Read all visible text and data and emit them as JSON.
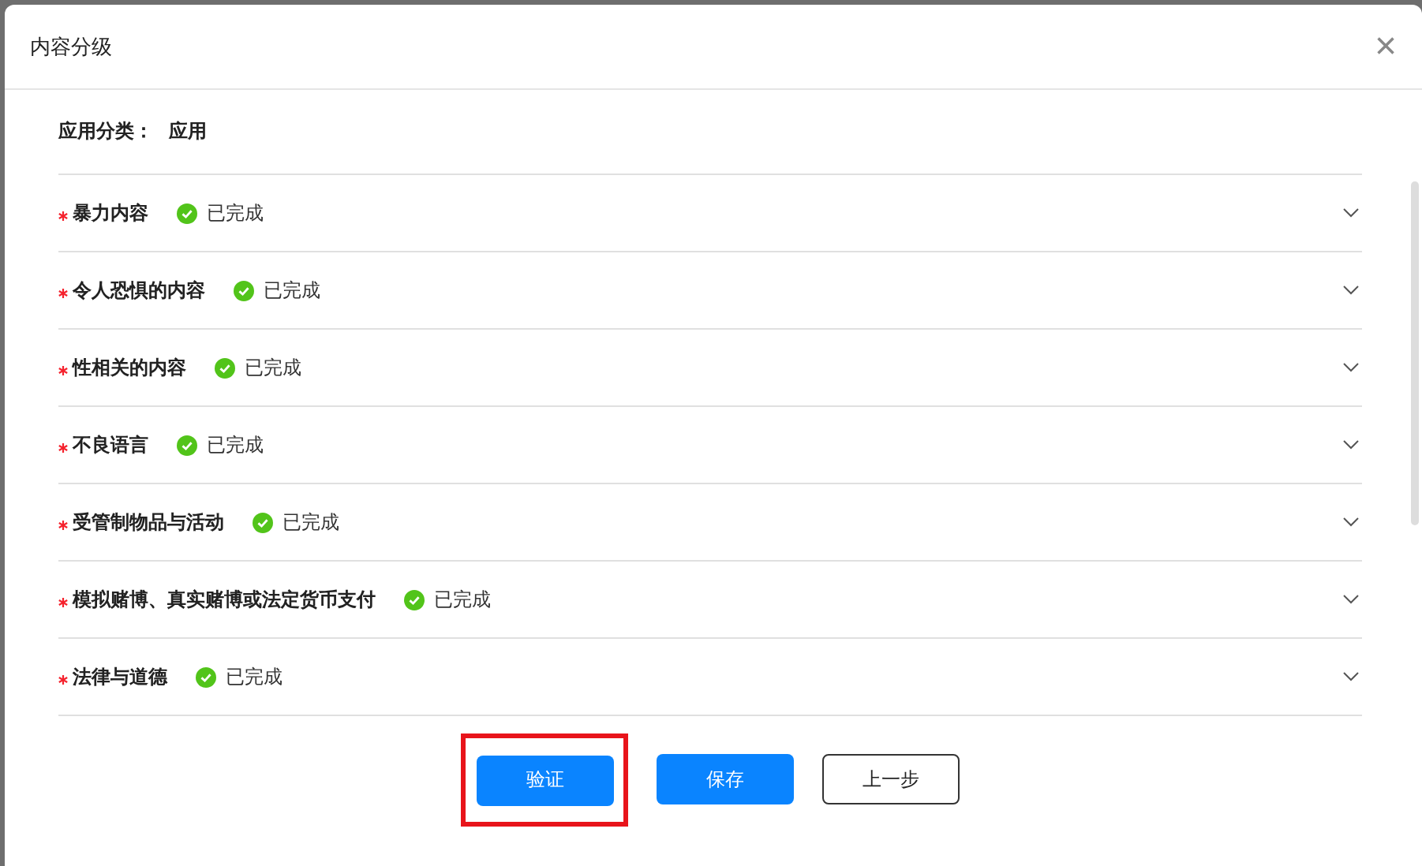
{
  "dialog": {
    "title": "内容分级",
    "close": "×"
  },
  "category": {
    "label": "应用分类：",
    "value": "应用"
  },
  "items": [
    {
      "label": "暴力内容",
      "required": true,
      "completed": true,
      "status": "已完成",
      "expanded": false
    },
    {
      "label": "令人恐惧的内容",
      "required": true,
      "completed": true,
      "status": "已完成",
      "expanded": false
    },
    {
      "label": "性相关的内容",
      "required": true,
      "completed": true,
      "status": "已完成",
      "expanded": false
    },
    {
      "label": "不良语言",
      "required": true,
      "completed": true,
      "status": "已完成",
      "expanded": false
    },
    {
      "label": "受管制物品与活动",
      "required": true,
      "completed": true,
      "status": "已完成",
      "expanded": false
    },
    {
      "label": "模拟赌博、真实赌博或法定货币支付",
      "required": true,
      "completed": true,
      "status": "已完成",
      "expanded": false
    },
    {
      "label": "法律与道德",
      "required": true,
      "completed": true,
      "status": "已完成",
      "expanded": false
    }
  ],
  "buttons": [
    {
      "label": "验证",
      "kind": "primary",
      "highlighted": true
    },
    {
      "label": "保存",
      "kind": "primary",
      "highlighted": false
    },
    {
      "label": "上一步",
      "kind": "default",
      "highlighted": false
    }
  ]
}
